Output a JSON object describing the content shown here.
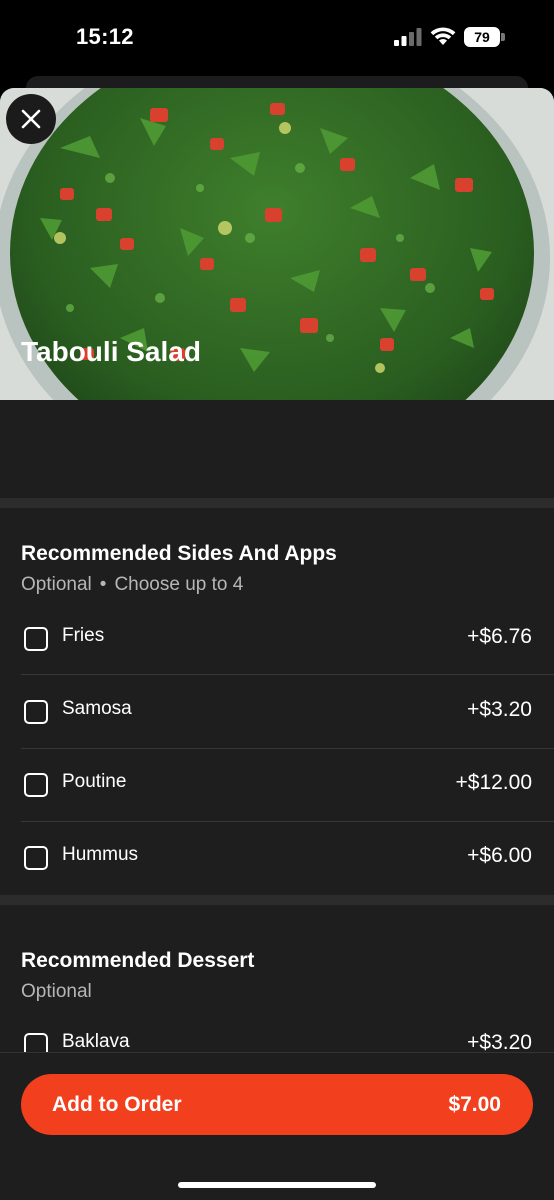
{
  "status_bar": {
    "time": "15:12",
    "battery": "79"
  },
  "item": {
    "title": "Tabouli Salad",
    "image_icon": "tabouli-photo"
  },
  "groups": [
    {
      "title": "Recommended Sides And Apps",
      "optional": "Optional",
      "choose": "Choose up to 4",
      "options": [
        {
          "name": "Fries",
          "price": "+$6.76"
        },
        {
          "name": "Samosa",
          "price": "+$3.20"
        },
        {
          "name": "Poutine",
          "price": "+$12.00"
        },
        {
          "name": "Hummus",
          "price": "+$6.00"
        }
      ]
    },
    {
      "title": "Recommended Dessert",
      "optional": "Optional",
      "options": [
        {
          "name": "Baklava",
          "price": "+$3.20"
        }
      ]
    }
  ],
  "cta": {
    "label": "Add to Order",
    "price": "$7.00"
  },
  "colors": {
    "accent": "#f2401f",
    "background": "#1e1e1e"
  }
}
